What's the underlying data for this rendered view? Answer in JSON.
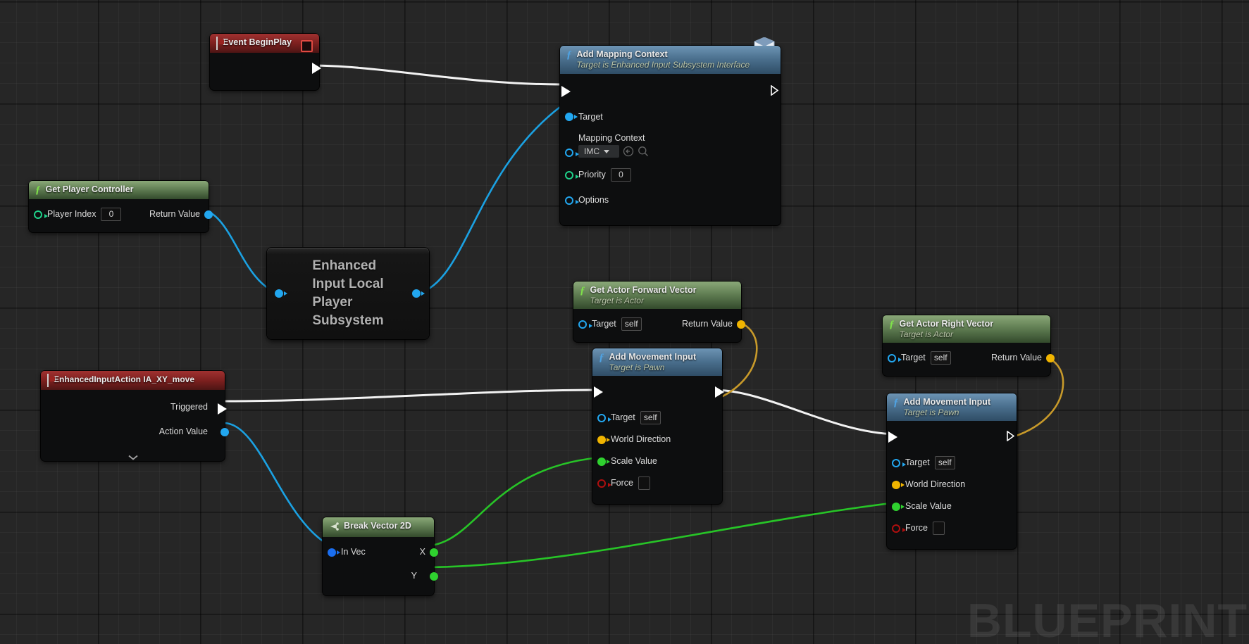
{
  "graph": {
    "watermark": "BLUEPRINT",
    "background_color": "#262626",
    "grid_color": "#2f2f2f"
  },
  "nodes": [
    {
      "id": "event-beginplay",
      "title": "Event BeginPlay",
      "subtitle": "",
      "kind": "event",
      "glyph": "event-diamond-icon",
      "badge": "red-square-badge",
      "outputs": [
        {
          "label": "",
          "type": "exec"
        }
      ]
    },
    {
      "id": "add-mapping-context",
      "title": "Add Mapping Context",
      "subtitle": "Target is Enhanced Input Subsystem Interface",
      "kind": "function",
      "glyph": "f-icon",
      "comment_bubble": "envelope-icon",
      "inputs": [
        {
          "label": "",
          "type": "exec"
        },
        {
          "label": "Target",
          "type": "object",
          "color": "#22a7f0"
        },
        {
          "label": "Mapping Context",
          "type": "object",
          "color": "#22a7f0",
          "widget": "dropdown",
          "value": "IMC"
        },
        {
          "label": "Priority",
          "type": "int",
          "color": "#1fd18a",
          "widget": "text",
          "value": "0"
        },
        {
          "label": "Options",
          "type": "struct",
          "color": "#22a7f0"
        }
      ],
      "outputs": [
        {
          "label": "",
          "type": "exec"
        }
      ]
    },
    {
      "id": "get-player-controller",
      "title": "Get Player Controller",
      "subtitle": "",
      "kind": "pure",
      "glyph": "f-icon",
      "inputs": [
        {
          "label": "Player Index",
          "type": "int",
          "color": "#1fd18a",
          "widget": "text",
          "value": "0"
        }
      ],
      "outputs": [
        {
          "label": "Return Value",
          "type": "object",
          "color": "#22a7f0"
        }
      ]
    },
    {
      "id": "enhanced-input-local-player-subsystem",
      "title": "Enhanced Input Local Player Subsystem",
      "kind": "plain",
      "inputs": [
        {
          "label": "",
          "type": "object",
          "color": "#22a7f0"
        }
      ],
      "outputs": [
        {
          "label": "",
          "type": "object",
          "color": "#22a7f0"
        }
      ]
    },
    {
      "id": "enhanced-input-action-ia-xy-move",
      "title": "EnhancedInputAction IA_XY_move",
      "kind": "event",
      "glyph": "event-diamond-icon",
      "outputs": [
        {
          "label": "Triggered",
          "type": "exec"
        },
        {
          "label": "Action Value",
          "type": "struct",
          "color": "#22a7f0"
        }
      ],
      "expander": "chevron-down-icon"
    },
    {
      "id": "get-actor-forward-vector",
      "title": "Get Actor Forward Vector",
      "subtitle": "Target is Actor",
      "kind": "pure",
      "glyph": "f-icon",
      "inputs": [
        {
          "label": "Target",
          "type": "object",
          "color": "#22a7f0",
          "widget": "self",
          "value": "self"
        }
      ],
      "outputs": [
        {
          "label": "Return Value",
          "type": "vector",
          "color": "#f0b400"
        }
      ]
    },
    {
      "id": "get-actor-right-vector",
      "title": "Get Actor Right Vector",
      "subtitle": "Target is Actor",
      "kind": "pure",
      "glyph": "f-icon",
      "inputs": [
        {
          "label": "Target",
          "type": "object",
          "color": "#22a7f0",
          "widget": "self",
          "value": "self"
        }
      ],
      "outputs": [
        {
          "label": "Return Value",
          "type": "vector",
          "color": "#f0b400"
        }
      ]
    },
    {
      "id": "add-movement-input-1",
      "title": "Add Movement Input",
      "subtitle": "Target is Pawn",
      "kind": "function",
      "glyph": "f-icon",
      "inputs": [
        {
          "label": "",
          "type": "exec"
        },
        {
          "label": "Target",
          "type": "object",
          "color": "#22a7f0",
          "widget": "self",
          "value": "self"
        },
        {
          "label": "World Direction",
          "type": "vector",
          "color": "#f0b400"
        },
        {
          "label": "Scale Value",
          "type": "float",
          "color": "#2fd12f"
        },
        {
          "label": "Force",
          "type": "bool",
          "color": "#b00f0f",
          "widget": "checkbox",
          "value": ""
        }
      ],
      "outputs": [
        {
          "label": "",
          "type": "exec"
        }
      ]
    },
    {
      "id": "add-movement-input-2",
      "title": "Add Movement Input",
      "subtitle": "Target is Pawn",
      "kind": "function",
      "glyph": "f-icon",
      "inputs": [
        {
          "label": "",
          "type": "exec"
        },
        {
          "label": "Target",
          "type": "object",
          "color": "#22a7f0",
          "widget": "self",
          "value": "self"
        },
        {
          "label": "World Direction",
          "type": "vector",
          "color": "#f0b400"
        },
        {
          "label": "Scale Value",
          "type": "float",
          "color": "#2fd12f"
        },
        {
          "label": "Force",
          "type": "bool",
          "color": "#b00f0f",
          "widget": "checkbox",
          "value": ""
        }
      ],
      "outputs": [
        {
          "label": "",
          "type": "exec"
        }
      ]
    },
    {
      "id": "break-vector-2d",
      "title": "Break Vector 2D",
      "kind": "pure",
      "glyph": "break-icon",
      "inputs": [
        {
          "label": "In Vec",
          "type": "struct",
          "color": "#1a6ef0"
        }
      ],
      "outputs": [
        {
          "label": "X",
          "type": "float",
          "color": "#2fd12f"
        },
        {
          "label": "Y",
          "type": "float",
          "color": "#2fd12f"
        }
      ]
    }
  ],
  "labels": {
    "event_beginplay": "Event BeginPlay",
    "add_mapping_context_title": "Add Mapping Context",
    "add_mapping_context_sub": "Target is Enhanced Input Subsystem Interface",
    "target": "Target",
    "mapping_context": "Mapping Context",
    "imc_value": "IMC",
    "priority": "Priority",
    "priority_value": "0",
    "options": "Options",
    "get_player_controller": "Get Player Controller",
    "player_index": "Player Index",
    "player_index_value": "0",
    "return_value": "Return Value",
    "subsystem_name": "Enhanced Input Local Player Subsystem",
    "subsystem_line1": "Enhanced",
    "subsystem_line2": "Input Local",
    "subsystem_line3": "Player",
    "subsystem_line4": "Subsystem",
    "input_action": "EnhancedInputAction IA_XY_move",
    "triggered": "Triggered",
    "action_value": "Action Value",
    "get_actor_forward_vector": "Get Actor Forward Vector",
    "get_actor_right_vector": "Get Actor Right Vector",
    "target_is_actor": "Target is Actor",
    "target_is_pawn": "Target is Pawn",
    "self_value": "self",
    "add_movement_input": "Add Movement Input",
    "world_direction": "World Direction",
    "scale_value": "Scale Value",
    "force": "Force",
    "break_vector_2d": "Break Vector 2D",
    "in_vec": "In Vec",
    "x": "X",
    "y": "Y"
  },
  "colors": {
    "exec_wire": "#f2f2f2",
    "object_wire": "#1ba1e2",
    "vector_wire": "#c89a2a",
    "float_wire": "#27c427",
    "struct_wire": "#2d7fe0",
    "node_body": "#0d0e0f",
    "fn_header": "#4a6f8d",
    "pure_header": "#5d7a50",
    "event_header": "#7d201f"
  }
}
